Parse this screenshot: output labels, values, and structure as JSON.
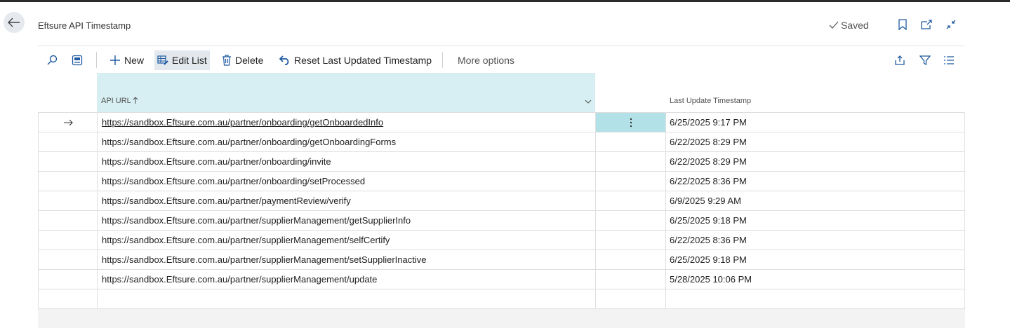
{
  "header": {
    "title": "Eftsure API Timestamp",
    "saved_label": "Saved"
  },
  "icons": {
    "back": "arrow-left-icon",
    "bookmark": "bookmark-icon",
    "open_new": "open-in-new-window-icon",
    "collapse": "collapse-icon",
    "search": "search-icon",
    "layout": "layout-icon",
    "share": "share-icon",
    "filter": "filter-icon",
    "list": "list-icon"
  },
  "actions": {
    "new": "New",
    "edit_list": "Edit List",
    "delete": "Delete",
    "reset": "Reset Last Updated Timestamp",
    "more": "More options"
  },
  "table": {
    "columns": {
      "url": "API URL",
      "timestamp": "Last Update Timestamp"
    },
    "rows": [
      {
        "url": "https://sandbox.Eftsure.com.au/partner/onboarding/getOnboardedInfo",
        "timestamp": "6/25/2025 9:17 PM"
      },
      {
        "url": "https://sandbox.Eftsure.com.au/partner/onboarding/getOnboardingForms",
        "timestamp": "6/22/2025 8:29 PM"
      },
      {
        "url": "https://sandbox.Eftsure.com.au/partner/onboarding/invite",
        "timestamp": "6/22/2025 8:29 PM"
      },
      {
        "url": "https://sandbox.Eftsure.com.au/partner/onboarding/setProcessed",
        "timestamp": "6/22/2025 8:36 PM"
      },
      {
        "url": "https://sandbox.Eftsure.com.au/partner/paymentReview/verify",
        "timestamp": "6/9/2025 9:29 AM"
      },
      {
        "url": "https://sandbox.Eftsure.com.au/partner/supplierManagement/getSupplierInfo",
        "timestamp": "6/25/2025 9:18 PM"
      },
      {
        "url": "https://sandbox.Eftsure.com.au/partner/supplierManagement/selfCertify",
        "timestamp": "6/22/2025 8:36 PM"
      },
      {
        "url": "https://sandbox.Eftsure.com.au/partner/supplierManagement/setSupplierInactive",
        "timestamp": "6/25/2025 9:18 PM"
      },
      {
        "url": "https://sandbox.Eftsure.com.au/partner/supplierManagement/update",
        "timestamp": "5/28/2025 10:06 PM"
      }
    ]
  }
}
